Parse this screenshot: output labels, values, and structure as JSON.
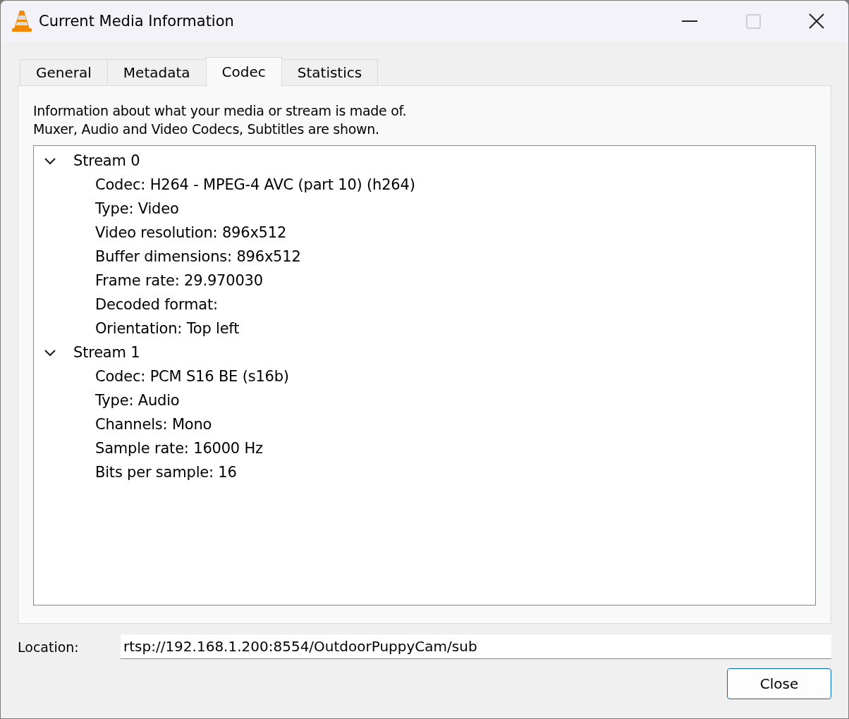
{
  "window": {
    "title": "Current Media Information",
    "maximize_disabled": true
  },
  "tabs": [
    {
      "label": "General",
      "selected": false
    },
    {
      "label": "Metadata",
      "selected": false
    },
    {
      "label": "Codec",
      "selected": true
    },
    {
      "label": "Statistics",
      "selected": false
    }
  ],
  "description": [
    "Information about what your media or stream is made of.",
    "Muxer, Audio and Video Codecs, Subtitles are shown."
  ],
  "tree": [
    {
      "label": "Stream 0",
      "expanded": true,
      "children": [
        {
          "label": "Codec: H264 - MPEG-4 AVC (part 10) (h264)"
        },
        {
          "label": "Type: Video"
        },
        {
          "label": "Video resolution: 896x512"
        },
        {
          "label": "Buffer dimensions: 896x512"
        },
        {
          "label": "Frame rate: 29.970030"
        },
        {
          "label": "Decoded format:"
        },
        {
          "label": "Orientation: Top left"
        }
      ]
    },
    {
      "label": "Stream 1",
      "expanded": true,
      "children": [
        {
          "label": "Codec: PCM S16 BE (s16b)"
        },
        {
          "label": "Type: Audio"
        },
        {
          "label": "Channels: Mono"
        },
        {
          "label": "Sample rate: 16000 Hz"
        },
        {
          "label": "Bits per sample: 16"
        }
      ]
    }
  ],
  "location": {
    "label": "Location:",
    "value": "rtsp://192.168.1.200:8554/OutdoorPuppyCam/sub"
  },
  "buttons": [
    "Close"
  ]
}
